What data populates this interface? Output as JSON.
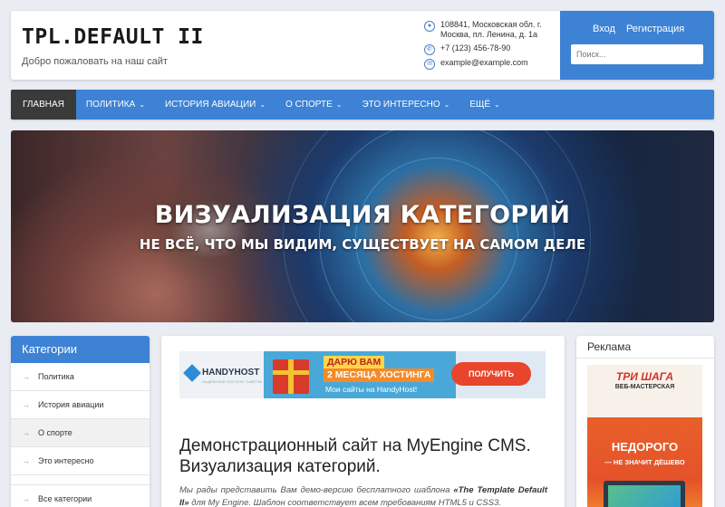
{
  "header": {
    "title": "TPL.DEFAULT II",
    "tagline": "Добро пожаловать на наш сайт",
    "contacts": {
      "address": "108841, Московская обл. г. Москва, пл. Ленина, д. 1а",
      "phone": "+7 (123) 456-78-90",
      "email": "example@example.com"
    },
    "auth": {
      "login_label": "Вход",
      "register_label": "Регистрация"
    },
    "search": {
      "placeholder": "Поиск..."
    }
  },
  "nav": {
    "items": [
      {
        "label": "ГЛАВНАЯ",
        "active": true,
        "dropdown": false
      },
      {
        "label": "ПОЛИТИКА",
        "dropdown": true
      },
      {
        "label": "ИСТОРИЯ АВИАЦИИ",
        "dropdown": true
      },
      {
        "label": "О СПОРТЕ",
        "dropdown": true
      },
      {
        "label": "ЭТО ИНТЕРЕСНО",
        "dropdown": true
      },
      {
        "label": "ЕЩЁ",
        "dropdown": true
      }
    ],
    "chevron": "⌄"
  },
  "hero": {
    "title": "ВИЗУАЛИЗАЦИЯ КАТЕГОРИЙ",
    "subtitle": "НЕ ВСЁ, ЧТО МЫ ВИДИМ, СУЩЕСТВУЕТ НА САМОМ ДЕЛЕ"
  },
  "sidebar": {
    "title": "Категории",
    "arrow": "→",
    "items": [
      {
        "label": "Политика"
      },
      {
        "label": "История авиации"
      },
      {
        "label": "О спорте"
      },
      {
        "label": "Это интересно"
      },
      {
        "label": "Все категории"
      }
    ]
  },
  "main": {
    "banner": {
      "logo": "HANDYHOST",
      "logo_sub": "НАДЁЖНЫЙ ХОСТИНГ САЙТОВ",
      "line1": "ДАРЮ ВАМ",
      "line2": "2 МЕСЯЦА ХОСТИНГА",
      "line3": "Мои сайты на HandyHost!",
      "cta": "ПОЛУЧИТЬ"
    },
    "title": "Демонстрационный сайт на MyEngine CMS. Визуализация категорий.",
    "text_start": "Мы рады представить Вам демо-версию бесплатного шаблона ",
    "text_bold": "«The Template Default II»",
    "text_end": " для My Engine. Шаблон соответствует всем требованиям HTML5 и CSS3."
  },
  "ad": {
    "title": "Реклама",
    "brand": "ТРИ ШАГА",
    "brand_sub": "ВЕБ-МАСТЕРСКАЯ",
    "line1": "НЕДОРОГО",
    "line2": "— НЕ ЗНАЧИТ ДЁШЕВО"
  },
  "colors": {
    "accent": "#3d82d4",
    "nav_active": "#3a3a3a",
    "page_bg": "#e9ecf2"
  }
}
